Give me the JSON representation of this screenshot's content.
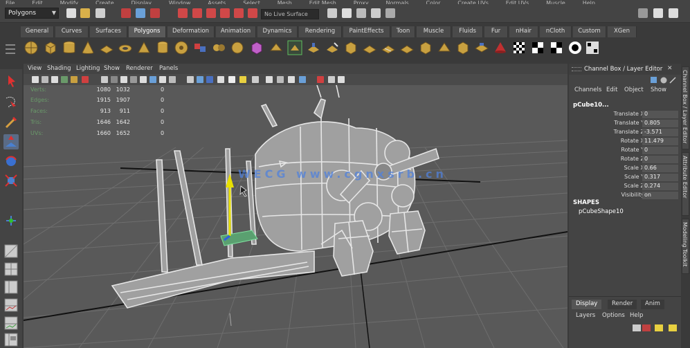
{
  "menubar": {
    "items": [
      "File",
      "Edit",
      "Modify",
      "Create",
      "Display",
      "Window",
      "Assets",
      "Select",
      "Mesh",
      "Edit Mesh",
      "Proxy",
      "Normals",
      "Color",
      "Create UVs",
      "Edit UVs",
      "Muscle",
      "Help"
    ]
  },
  "statusline": {
    "mode": "Polygons",
    "live_surface": "No Live Surface"
  },
  "shelf": {
    "tabs": [
      "General",
      "Curves",
      "Surfaces",
      "Polygons",
      "Deformation",
      "Animation",
      "Dynamics",
      "Rendering",
      "PaintEffects",
      "Toon",
      "Muscle",
      "Fluids",
      "Fur",
      "nHair",
      "nCloth",
      "Custom",
      "XGen"
    ],
    "active_tab": "Polygons"
  },
  "viewport": {
    "menu": [
      "View",
      "Shading",
      "Lighting",
      "Show",
      "Renderer",
      "Panels"
    ],
    "hud": [
      {
        "label": "Verts:",
        "a": "1080",
        "b": "1032",
        "c": "0"
      },
      {
        "label": "Edges:",
        "a": "1915",
        "b": "1907",
        "c": "0"
      },
      {
        "label": "Faces:",
        "a": "913",
        "b": "911",
        "c": "0"
      },
      {
        "label": "Tris:",
        "a": "1646",
        "b": "1642",
        "c": "0"
      },
      {
        "label": "UVs:",
        "a": "1660",
        "b": "1652",
        "c": "0"
      }
    ],
    "watermark": "WECG www.cgnxsrb.cn"
  },
  "channel_box": {
    "title": "Channel Box / Layer Editor",
    "menu": [
      "Channels",
      "Edit",
      "Object",
      "Show"
    ],
    "object": "pCube10...",
    "attributes": [
      {
        "name": "Translate X",
        "value": "0"
      },
      {
        "name": "Translate Y",
        "value": "0.805"
      },
      {
        "name": "Translate Z",
        "value": "-3.571"
      },
      {
        "name": "Rotate X",
        "value": "11.479"
      },
      {
        "name": "Rotate Y",
        "value": "0"
      },
      {
        "name": "Rotate Z",
        "value": "0"
      },
      {
        "name": "Scale X",
        "value": "0.66"
      },
      {
        "name": "Scale Y",
        "value": "0.317"
      },
      {
        "name": "Scale Z",
        "value": "0.274"
      },
      {
        "name": "Visibility",
        "value": "on"
      }
    ],
    "shapes_label": "SHAPES",
    "shape_name": "pCubeShape10"
  },
  "side_tabs": [
    "Channel Box / Layer Editor",
    "Attribute Editor",
    "Modeling Toolkit"
  ],
  "layer_editor": {
    "tabs": [
      "Display",
      "Render",
      "Anim"
    ],
    "active_tab": "Display",
    "menu": [
      "Layers",
      "Options",
      "Help"
    ]
  },
  "colors": {
    "accent": "#5a6b86",
    "hud_label": "#6a9a6a",
    "grid": "#6a6a6a",
    "wire": "#e6e6e6",
    "manip_y": "#e8e000"
  }
}
